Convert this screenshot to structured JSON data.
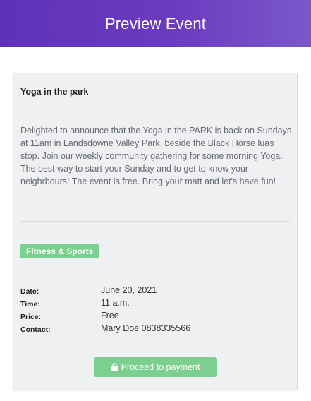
{
  "header": {
    "title": "Preview Event"
  },
  "event": {
    "title": "Yoga in the park",
    "description": "Delighted to announce that the Yoga in the PARK is back on Sundays at 11am in Landsdowne Valley Park, beside the Black Horse luas stop. Join our weekly community gathering for some morning Yoga. The best way to start your Sunday and to get to know your neighrbours! The event is free. Bring your matt and let's have fun!",
    "category": "Fitness & Sports",
    "details": {
      "date_label": "Date:",
      "date_value": "June 20, 2021",
      "time_label": "Time:",
      "time_value": "11 a.m.",
      "price_label": "Price:",
      "price_value": "Free",
      "contact_label": "Contact:",
      "contact_value": "Mary Doe 0838335566"
    }
  },
  "actions": {
    "pay_label": "Proceed to payment",
    "pay_icon": "lock-icon"
  },
  "colors": {
    "header_start": "#5e32b8",
    "header_end": "#7b58c9",
    "accent_green": "#7ccf8f",
    "card_bg": "#eff0f2"
  }
}
